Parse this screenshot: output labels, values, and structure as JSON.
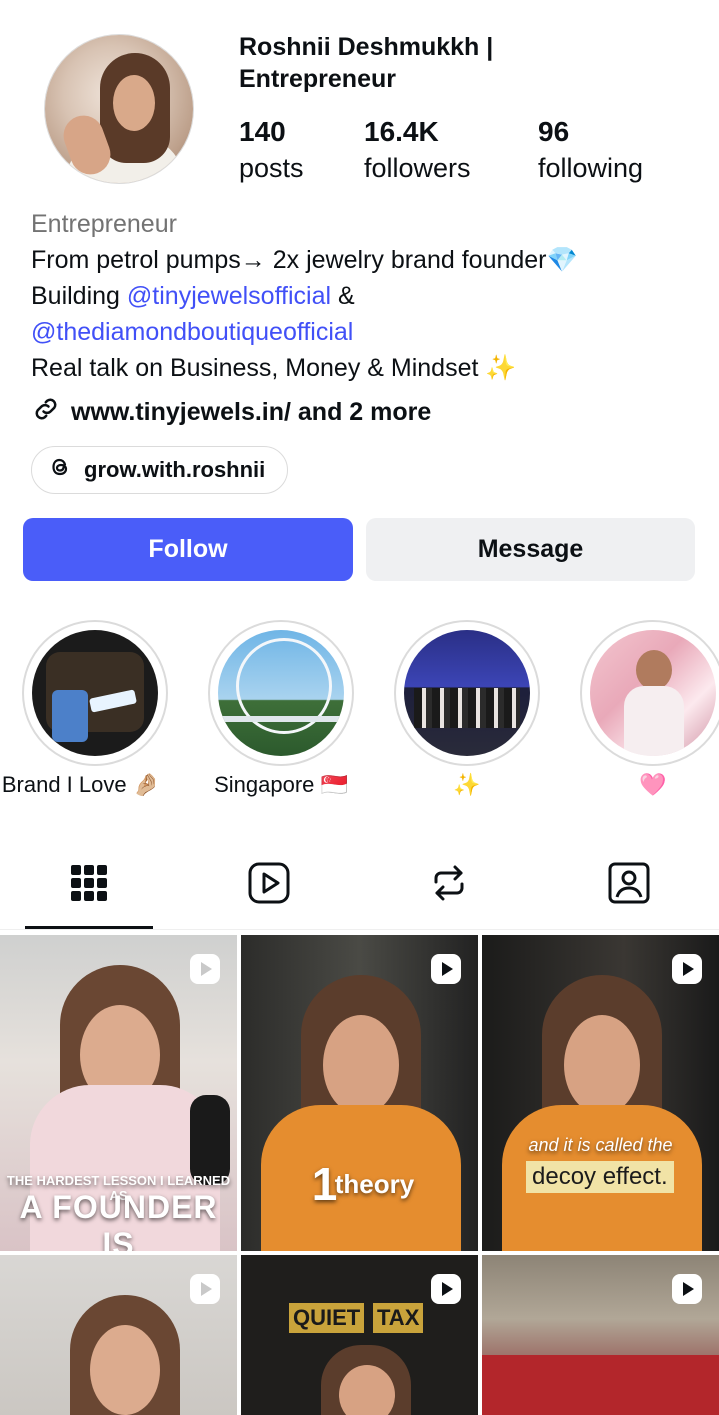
{
  "profile": {
    "name": "Roshnii Deshmukkh | Entrepreneur",
    "stats": [
      {
        "value": "140",
        "label": "posts"
      },
      {
        "value": "16.4K",
        "label": "followers"
      },
      {
        "value": "96",
        "label": "following"
      }
    ],
    "category": "Entrepreneur",
    "bio_line1": "From petrol pumps→ 2x jewelry brand founder💎",
    "bio_line2_prefix": "Building ",
    "bio_mention1": "@tinyjewelsofficial",
    "bio_line2_suffix": " &",
    "bio_mention2": "@thediamondboutiqueofficial",
    "bio_line4": "Real talk on Business, Money & Mindset ✨",
    "link_text": "www.tinyjewels.in/ and 2 more",
    "threads_handle": "grow.with.roshnii"
  },
  "actions": {
    "follow_label": "Follow",
    "message_label": "Message",
    "follow_color": "#4a5df9"
  },
  "highlights": [
    {
      "label": "Brand I Love 🤌🏼"
    },
    {
      "label": "Singapore 🇸🇬"
    },
    {
      "label": "✨"
    },
    {
      "label": "🩷"
    }
  ],
  "tabs": [
    {
      "icon": "grid-icon"
    },
    {
      "icon": "reels-icon"
    },
    {
      "icon": "reposts-icon"
    },
    {
      "icon": "tagged-icon"
    }
  ],
  "grid": [
    {
      "caption_top": "THE HARDEST LESSON I LEARNED AS",
      "caption_main": "A FOUNDER IS"
    },
    {
      "caption_num": "1",
      "caption_word": "theory"
    },
    {
      "caption_small": "and it is called the",
      "caption_box": "decoy effect."
    },
    {},
    {
      "caption_box1": "QUIET",
      "caption_box2": "TAX"
    },
    {}
  ]
}
